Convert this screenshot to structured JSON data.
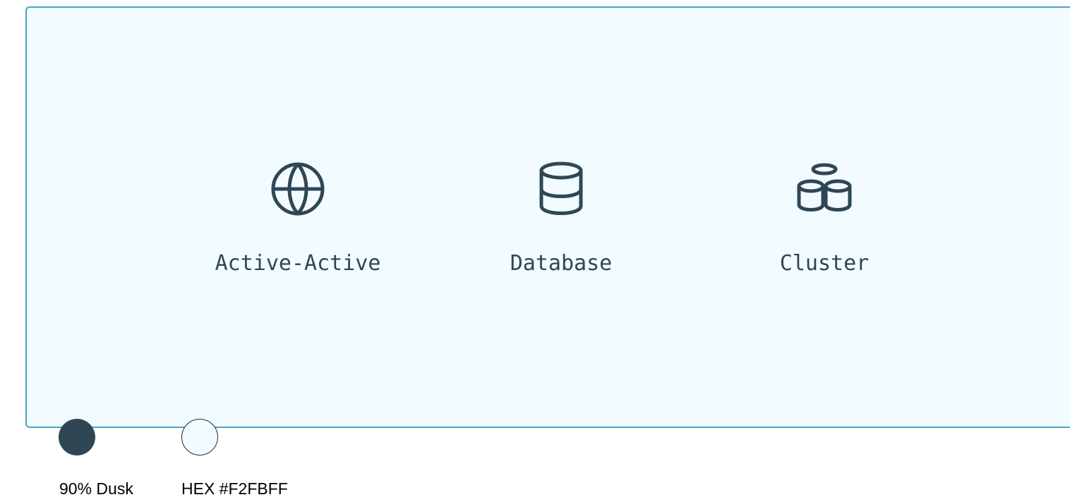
{
  "colors": {
    "panel_bg": "#F2FBFF",
    "panel_border": "#4AA3C8",
    "icon_color": "#2F4755"
  },
  "icons": [
    {
      "name": "globe-icon",
      "label": "Active-Active"
    },
    {
      "name": "database-icon",
      "label": "Database"
    },
    {
      "name": "cluster-icon",
      "label": "Cluster"
    }
  ],
  "swatches": [
    {
      "label": "90% Dusk",
      "color": "#2F4755"
    },
    {
      "label": "HEX #F2FBFF",
      "color": "#F2FBFF"
    }
  ]
}
